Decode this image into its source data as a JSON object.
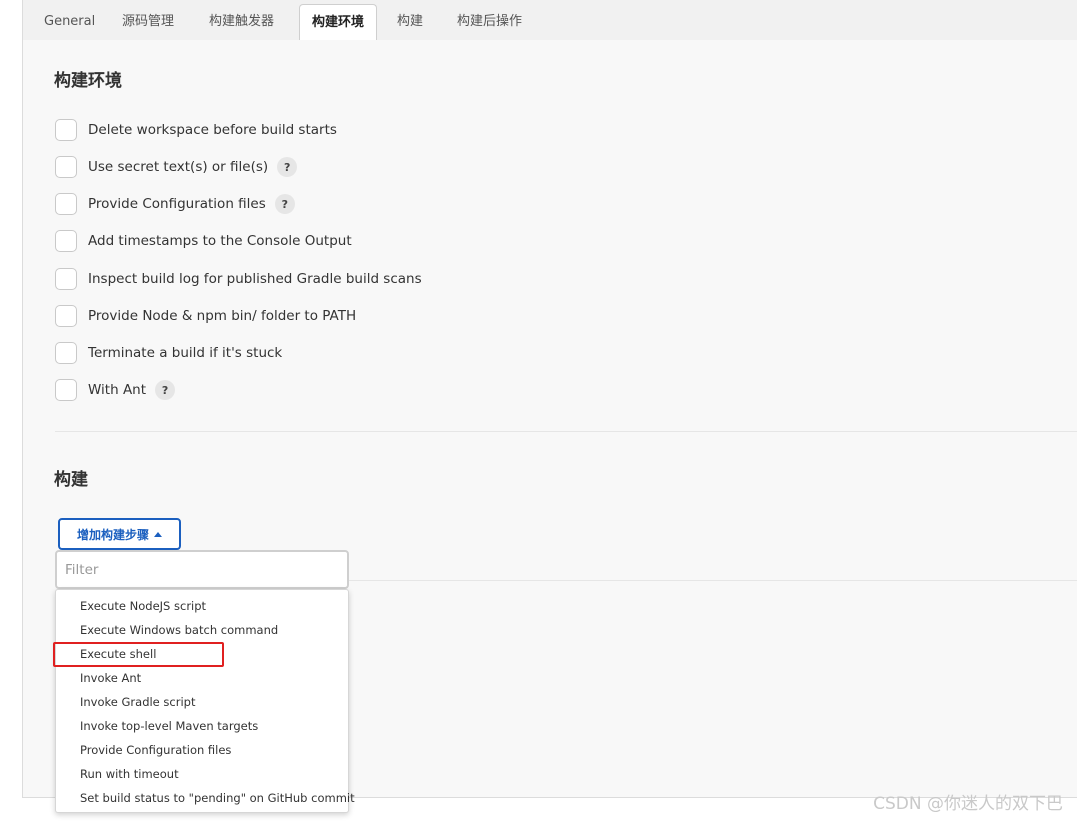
{
  "tabs": [
    {
      "label": "General",
      "active": false
    },
    {
      "label": "源码管理",
      "active": false
    },
    {
      "label": "构建触发器",
      "active": false
    },
    {
      "label": "构建环境",
      "active": true
    },
    {
      "label": "构建",
      "active": false
    },
    {
      "label": "构建后操作",
      "active": false
    }
  ],
  "build_env": {
    "title": "构建环境",
    "options": [
      {
        "label": "Delete workspace before build starts",
        "checked": false,
        "help": false
      },
      {
        "label": "Use secret text(s) or file(s)",
        "checked": false,
        "help": true
      },
      {
        "label": "Provide Configuration files",
        "checked": false,
        "help": true
      },
      {
        "label": "Add timestamps to the Console Output",
        "checked": false,
        "help": false
      },
      {
        "label": "Inspect build log for published Gradle build scans",
        "checked": false,
        "help": false
      },
      {
        "label": "Provide Node & npm bin/ folder to PATH",
        "checked": false,
        "help": false
      },
      {
        "label": "Terminate a build if it's stuck",
        "checked": false,
        "help": false
      },
      {
        "label": "With Ant",
        "checked": false,
        "help": true
      }
    ],
    "help_symbol": "?"
  },
  "build": {
    "title": "构建",
    "add_button": "增加构建步骤",
    "filter_placeholder": "Filter",
    "filter_value": "",
    "menu_items": [
      "Execute NodeJS script",
      "Execute Windows batch command",
      "Execute shell",
      "Invoke Ant",
      "Invoke Gradle script",
      "Invoke top-level Maven targets",
      "Provide Configuration files",
      "Run with timeout",
      "Set build status to \"pending\" on GitHub commit"
    ],
    "highlighted_item": "Execute shell"
  },
  "watermark": "CSDN @你迷人的双下巴",
  "colors": {
    "accent": "#1b5fbf",
    "highlight": "#e02020"
  }
}
